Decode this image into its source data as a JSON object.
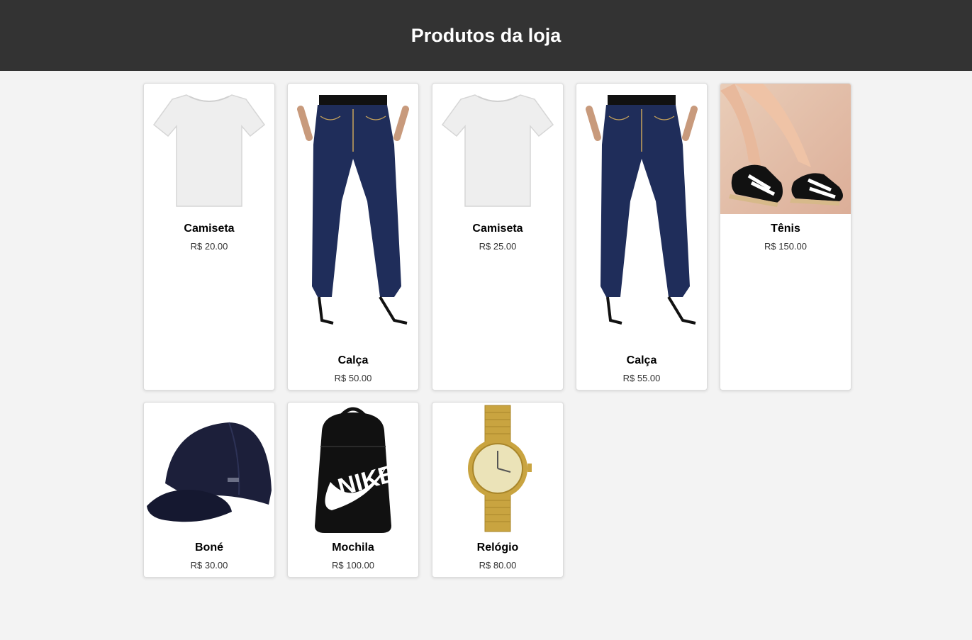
{
  "page": {
    "title": "Produtos da loja"
  },
  "products": [
    {
      "name": "Camiseta",
      "price": "R$ 20.00",
      "icon": "tshirt-icon"
    },
    {
      "name": "Calça",
      "price": "R$ 50.00",
      "icon": "jeans-icon"
    },
    {
      "name": "Camiseta",
      "price": "R$ 25.00",
      "icon": "tshirt-icon"
    },
    {
      "name": "Calça",
      "price": "R$ 55.00",
      "icon": "jeans-icon"
    },
    {
      "name": "Tênis",
      "price": "R$ 150.00",
      "icon": "sneakers-icon"
    },
    {
      "name": "Boné",
      "price": "R$ 30.00",
      "icon": "cap-icon"
    },
    {
      "name": "Mochila",
      "price": "R$ 100.00",
      "icon": "backpack-icon"
    },
    {
      "name": "Relógio",
      "price": "R$ 80.00",
      "icon": "watch-icon"
    }
  ],
  "colors": {
    "header_bg": "#333333",
    "page_bg": "#f3f3f3",
    "card_bg": "#ffffff"
  }
}
